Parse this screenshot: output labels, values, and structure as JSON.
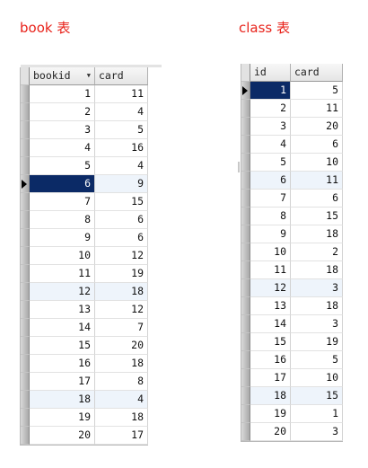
{
  "book_caption": "book 表",
  "class_caption": "class 表",
  "book_table": {
    "columns": [
      "bookid",
      "card"
    ],
    "sort_icon": "sort-down-arrow",
    "current_row": 6,
    "rows": [
      [
        "1",
        "11"
      ],
      [
        "2",
        "4"
      ],
      [
        "3",
        "5"
      ],
      [
        "4",
        "16"
      ],
      [
        "5",
        "4"
      ],
      [
        "6",
        "9"
      ],
      [
        "7",
        "15"
      ],
      [
        "8",
        "6"
      ],
      [
        "9",
        "6"
      ],
      [
        "10",
        "12"
      ],
      [
        "11",
        "19"
      ],
      [
        "12",
        "18"
      ],
      [
        "13",
        "12"
      ],
      [
        "14",
        "7"
      ],
      [
        "15",
        "20"
      ],
      [
        "16",
        "18"
      ],
      [
        "17",
        "8"
      ],
      [
        "18",
        "4"
      ],
      [
        "19",
        "18"
      ],
      [
        "20",
        "17"
      ]
    ]
  },
  "class_table": {
    "columns": [
      "id",
      "card"
    ],
    "current_row": 1,
    "rows": [
      [
        "1",
        "5"
      ],
      [
        "2",
        "11"
      ],
      [
        "3",
        "20"
      ],
      [
        "4",
        "6"
      ],
      [
        "5",
        "10"
      ],
      [
        "6",
        "11"
      ],
      [
        "7",
        "6"
      ],
      [
        "8",
        "15"
      ],
      [
        "9",
        "18"
      ],
      [
        "10",
        "2"
      ],
      [
        "11",
        "18"
      ],
      [
        "12",
        "3"
      ],
      [
        "13",
        "18"
      ],
      [
        "14",
        "3"
      ],
      [
        "15",
        "19"
      ],
      [
        "16",
        "5"
      ],
      [
        "17",
        "10"
      ],
      [
        "18",
        "15"
      ],
      [
        "19",
        "1"
      ],
      [
        "20",
        "3"
      ]
    ]
  },
  "colors": {
    "caption": "#e8231b",
    "current_cell": "#0b2a66",
    "alt_row": "#eef4fb"
  }
}
